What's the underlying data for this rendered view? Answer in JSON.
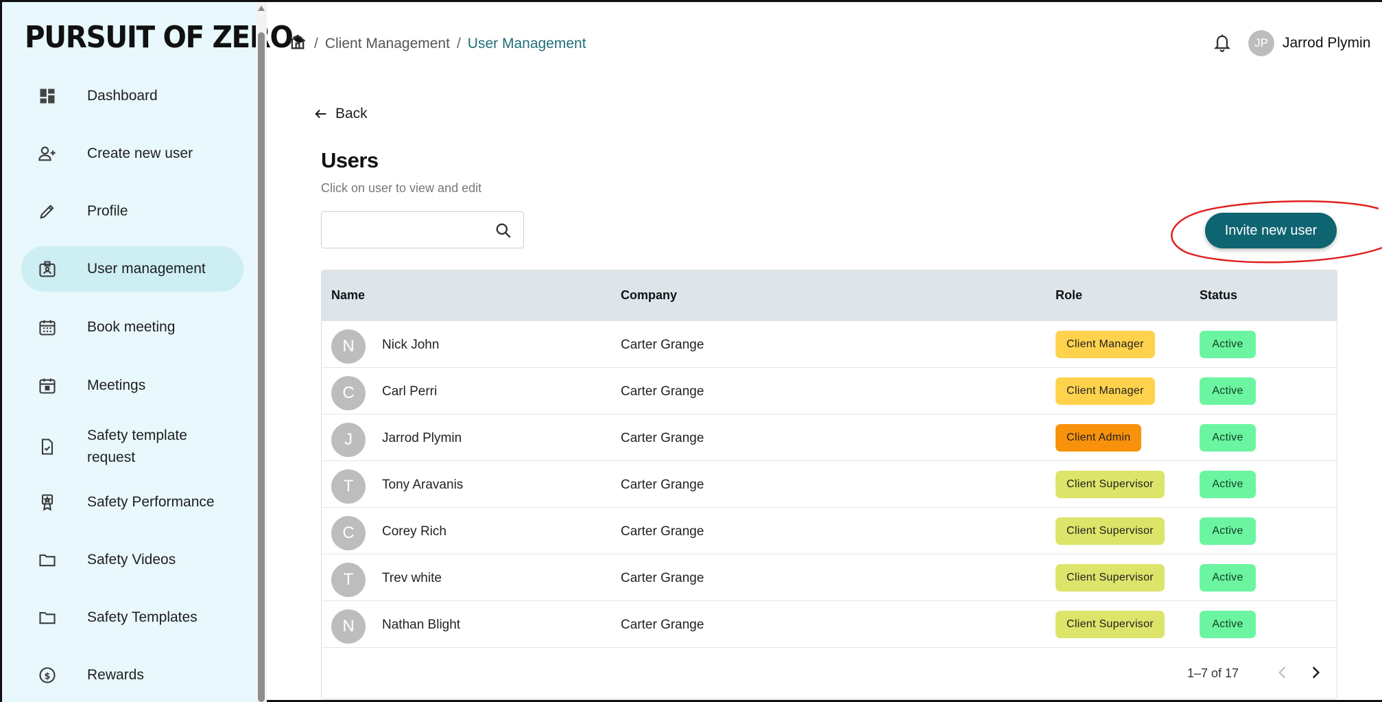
{
  "brand": {
    "logo_text": "PURSUIT OF ZERO"
  },
  "sidebar": {
    "items": [
      {
        "label": "Dashboard",
        "icon": "dashboard-icon"
      },
      {
        "label": "Create new user",
        "icon": "person-add-icon"
      },
      {
        "label": "Profile",
        "icon": "pencil-icon"
      },
      {
        "label": "User management",
        "icon": "id-card-icon",
        "active": true
      },
      {
        "label": "Book meeting",
        "icon": "calendar-grid-icon"
      },
      {
        "label": "Meetings",
        "icon": "calendar-icon"
      },
      {
        "label": "Safety template request",
        "label_line1": "Safety template",
        "label_line2": "request",
        "icon": "document-check-icon"
      },
      {
        "label": "Safety Performance",
        "icon": "award-icon"
      },
      {
        "label": "Safety Videos",
        "icon": "folder-icon"
      },
      {
        "label": "Safety Templates",
        "icon": "folder-icon"
      },
      {
        "label": "Rewards",
        "icon": "dollar-coin-icon"
      }
    ]
  },
  "header": {
    "breadcrumb": [
      "Client Management",
      "User Management"
    ],
    "separator": "/",
    "user_initials": "JP",
    "user_name": "Jarrod Plymin"
  },
  "main": {
    "back_label": "Back",
    "title": "Users",
    "subtitle": "Click on user to view and edit",
    "search": {
      "value": "",
      "placeholder": ""
    },
    "invite_label": "Invite new user",
    "highlight_color": "#e02020",
    "accent_color": "#0e6470"
  },
  "table": {
    "columns": [
      "Name",
      "Company",
      "Role",
      "Status"
    ],
    "rows": [
      {
        "initial": "N",
        "name": "Nick John",
        "company": "Carter Grange",
        "role": "Client Manager",
        "status": "Active"
      },
      {
        "initial": "C",
        "name": "Carl Perri",
        "company": "Carter Grange",
        "role": "Client Manager",
        "status": "Active"
      },
      {
        "initial": "J",
        "name": "Jarrod Plymin",
        "company": "Carter Grange",
        "role": "Client Admin",
        "status": "Active"
      },
      {
        "initial": "T",
        "name": "Tony Aravanis",
        "company": "Carter Grange",
        "role": "Client Supervisor",
        "status": "Active"
      },
      {
        "initial": "C",
        "name": "Corey Rich",
        "company": "Carter Grange",
        "role": "Client Supervisor",
        "status": "Active"
      },
      {
        "initial": "T",
        "name": "Trev white",
        "company": "Carter Grange",
        "role": "Client Supervisor",
        "status": "Active"
      },
      {
        "initial": "N",
        "name": "Nathan Blight",
        "company": "Carter Grange",
        "role": "Client Supervisor",
        "status": "Active"
      }
    ],
    "role_colors": {
      "Client Manager": "#ffd24d",
      "Client Admin": "#f8920c",
      "Client Supervisor": "#dde46a"
    },
    "status_color": "#6bf5a0",
    "pagination": "1–7 of 17"
  }
}
